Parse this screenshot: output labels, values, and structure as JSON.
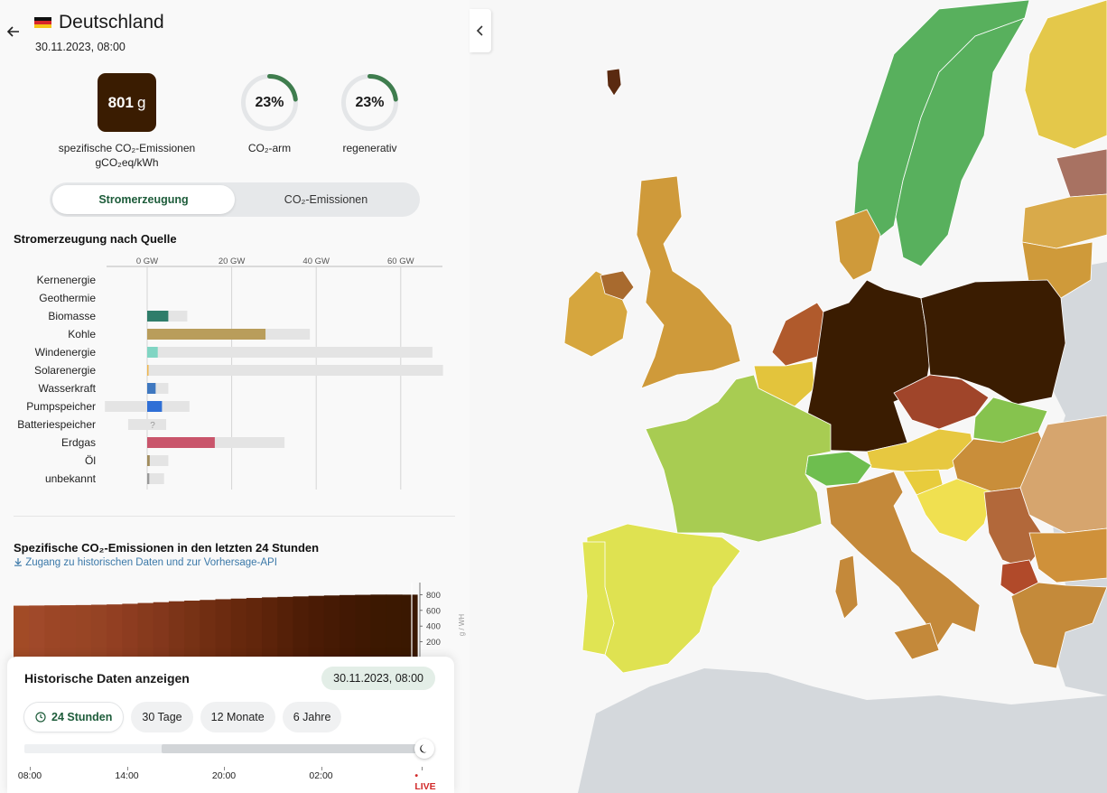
{
  "zone": {
    "name": "Deutschland",
    "datetime": "30.11.2023, 08:00"
  },
  "metrics": {
    "intensity_value": "801",
    "intensity_unit": "g",
    "intensity_label_line1": "spezifische CO₂-Emissionen",
    "intensity_label_line2": "gCO₂eq/kWh",
    "intensity_color": "#3a1c01",
    "low_carbon": {
      "value": "23%",
      "label": "CO₂-arm",
      "fraction": 0.23
    },
    "renewable": {
      "value": "23%",
      "label": "regenerativ",
      "fraction": 0.23
    },
    "ring_color": "#3f7d4e"
  },
  "toggle": {
    "items": [
      "Stromerzeugung",
      "CO₂-Emissionen"
    ],
    "active": 0
  },
  "production": {
    "title": "Stromerzeugung nach Quelle",
    "chart_data": {
      "type": "bar",
      "unit": "GW",
      "xlim": [
        -10,
        70
      ],
      "ticks": [
        {
          "value": 0,
          "label": "0 GW"
        },
        {
          "value": 20,
          "label": "20 GW"
        },
        {
          "value": 40,
          "label": "40 GW"
        },
        {
          "value": 60,
          "label": "60 GW"
        }
      ],
      "rows": [
        {
          "label": "Kernenergie",
          "value": 0,
          "capacity": 0,
          "color": "#9b59b6"
        },
        {
          "label": "Geothermie",
          "value": 0,
          "capacity": 0,
          "color": "#b5651d"
        },
        {
          "label": "Biomasse",
          "value": 5,
          "capacity": 9.5,
          "color": "#2f7d6a"
        },
        {
          "label": "Kohle",
          "value": 28,
          "capacity": 38.5,
          "color": "#b99d5b"
        },
        {
          "label": "Windenergie",
          "value": 2.5,
          "capacity": 67.5,
          "color": "#80d5c3"
        },
        {
          "label": "Solarenergie",
          "value": 0.3,
          "capacity": 70,
          "color": "#f0b64d"
        },
        {
          "label": "Wasserkraft",
          "value": 2,
          "capacity": 5,
          "color": "#3f78c0"
        },
        {
          "label": "Pumpspeicher",
          "value": 3.5,
          "capacity": 10,
          "negative_capacity": -10,
          "color": "#2f6fd6"
        },
        {
          "label": "Batteriespeicher",
          "value": 0,
          "capacity": 4.5,
          "negative_capacity": -4.5,
          "color": "#c6c6c6",
          "unknown_mark": "?"
        },
        {
          "label": "Erdgas",
          "value": 16,
          "capacity": 32.5,
          "color": "#c9556b"
        },
        {
          "label": "Öl",
          "value": 0.6,
          "capacity": 5,
          "color": "#a08c5c"
        },
        {
          "label": "unbekannt",
          "value": 0.5,
          "capacity": 4,
          "color": "#999999"
        }
      ]
    }
  },
  "emissions_history": {
    "title": "Spezifische CO₂-Emissionen in den letzten 24 Stunden",
    "link_text": "Zugang zu historischen Daten und zur Vorhersage-API",
    "chart_data": {
      "type": "area",
      "unit_label": "g / WH",
      "yticks": [
        200,
        400,
        600,
        800
      ],
      "ylim": [
        0,
        860
      ],
      "values": [
        660,
        662,
        664,
        666,
        668,
        672,
        676,
        684,
        694,
        704,
        716,
        724,
        733,
        742,
        750,
        758,
        766,
        772,
        778,
        785,
        790,
        795,
        798,
        801,
        801,
        800
      ],
      "colors": [
        "#a24b26",
        "#a0492a",
        "#9c4626",
        "#9a4526",
        "#984525",
        "#954324",
        "#923f22",
        "#8d3c20",
        "#873a1d",
        "#83371c",
        "#7c3418",
        "#773215",
        "#712e12",
        "#6c2b10",
        "#66280d",
        "#62260c",
        "#5c230a",
        "#552008",
        "#4e1d06",
        "#4a1b05",
        "#461a04",
        "#421803",
        "#3f1802",
        "#3c1801",
        "#3b1801",
        "#3a1801"
      ]
    }
  },
  "history": {
    "title": "Historische Daten anzeigen",
    "date_badge": "30.11.2023, 08:00",
    "chips": [
      {
        "label": "24 Stunden",
        "icon": "clock-icon"
      },
      {
        "label": "30 Tage"
      },
      {
        "label": "12 Monate"
      },
      {
        "label": "6 Jahre"
      }
    ],
    "active_chip": 0,
    "slider_position": 1.0,
    "slider_range_start": 0.345,
    "ticks": [
      {
        "label": "08:00",
        "pos": 0.0
      },
      {
        "label": "14:00",
        "pos": 0.25
      },
      {
        "label": "20:00",
        "pos": 0.5
      },
      {
        "label": "02:00",
        "pos": 0.75
      },
      {
        "label": "LIVE",
        "pos": 1.0,
        "live": true
      }
    ]
  },
  "map": {
    "collapse_icon": "chevron-left-icon",
    "country_colors": {
      "Norwegen": "#58b05d",
      "Schweden": "#58b05d",
      "Finnland": "#e4c84a",
      "Estland": "#a87262",
      "Lettland": "#d9aa4a",
      "Litauen": "#cf9a3a",
      "Dänemark": "#cf9a3a",
      "Großbritannien": "#cf9a3a",
      "Irland": "#d6a63e",
      "Nordirland": "#a86a2e",
      "Niederlande": "#b05a2c",
      "Belgien": "#e3c43c",
      "Deutschland": "#3a1c01",
      "Polen": "#3a1c01",
      "Tschechien": "#a0452a",
      "Slowakei": "#86c34e",
      "Frankreich": "#a8cc52",
      "Schweiz": "#6ebe4f",
      "Österreich": "#e7c840",
      "Ungarn": "#c98e3a",
      "Rumänien": "#d6a56e",
      "Italien": "#c4893a",
      "Spanien": "#dfe251",
      "Portugal": "#e0e453",
      "Slowenien": "#e8cc3c",
      "Kroatien": "#f0e050",
      "Serbien": "#b2683a",
      "Nordmazedonien": "#b14a2a",
      "Griechenland": "#c48a3a",
      "Bulgarien": "#cf913a",
      "Färöer": "#5a2a10"
    }
  }
}
